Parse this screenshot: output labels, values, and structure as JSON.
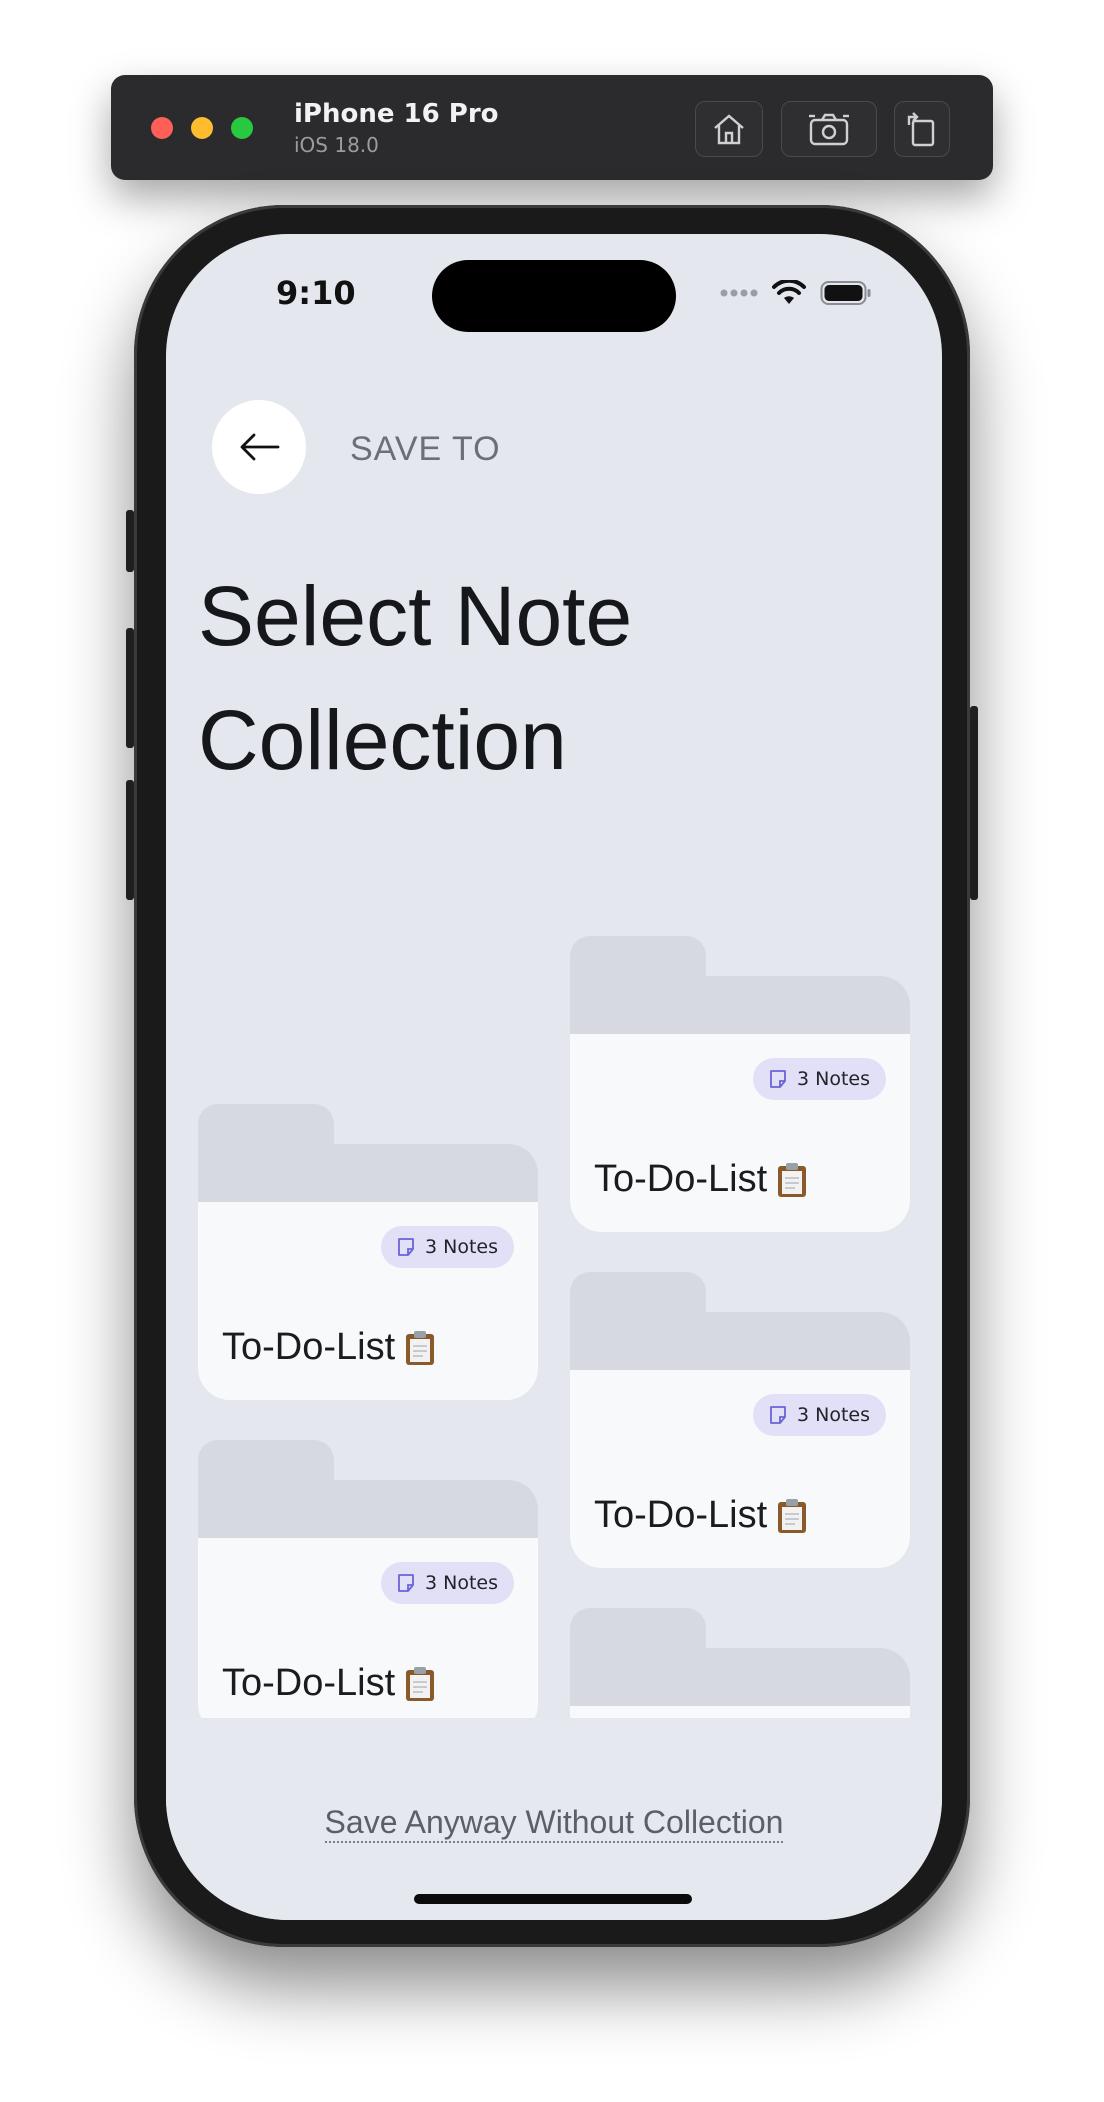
{
  "simulator": {
    "device_name": "iPhone 16 Pro",
    "os_version": "iOS 18.0",
    "buttons": [
      {
        "icon": "home-icon"
      },
      {
        "icon": "screenshot-icon"
      },
      {
        "icon": "rotate-icon"
      }
    ]
  },
  "status_bar": {
    "time": "9:10",
    "icons": [
      "cellular-dots-icon",
      "wifi-icon",
      "battery-icon"
    ]
  },
  "header": {
    "back_icon": "arrow-left-icon",
    "label": "SAVE TO"
  },
  "page_title_line1": "Select Note",
  "page_title_line2": "Collection",
  "collections": [
    {
      "title": "To-Do-List",
      "emoji_icon": "clipboard-icon",
      "badge_text": "3 Notes",
      "badge_icon": "note-icon"
    },
    {
      "title": "To-Do-List",
      "emoji_icon": "clipboard-icon",
      "badge_text": "3 Notes",
      "badge_icon": "note-icon"
    },
    {
      "title": "To-Do-List",
      "emoji_icon": "clipboard-icon",
      "badge_text": "3 Notes",
      "badge_icon": "note-icon"
    },
    {
      "title": "To-Do-List",
      "emoji_icon": "clipboard-icon",
      "badge_text": "3 Notes",
      "badge_icon": "note-icon"
    },
    {
      "title": "",
      "emoji_icon": "",
      "badge_text": "",
      "badge_icon": ""
    }
  ],
  "footer": {
    "save_anyway_label": "Save Anyway Without Collection"
  },
  "colors": {
    "screen_bg": "#e4e7ee",
    "card_body": "#f8f9fb",
    "folder_tab": "#d6d9e0",
    "badge_bg": "#e1e0f7",
    "badge_icon": "#6b63d8"
  }
}
